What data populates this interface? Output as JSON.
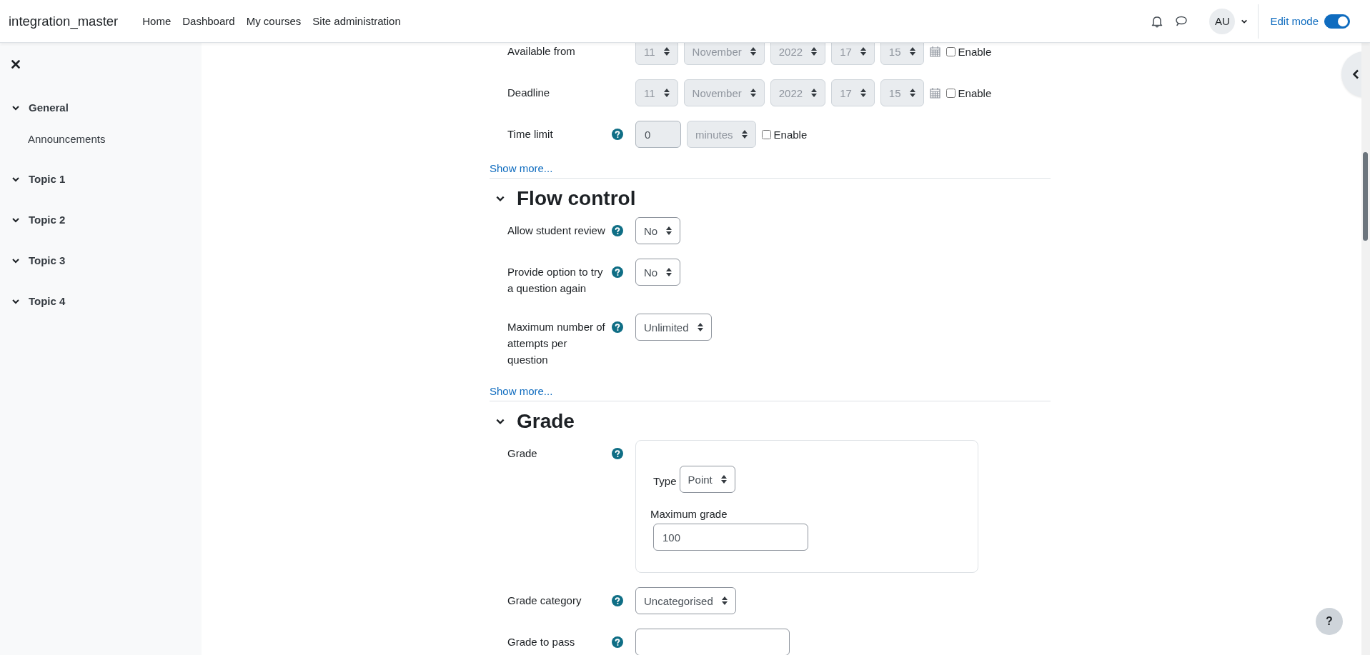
{
  "navbar": {
    "site_name": "integration_master",
    "links": [
      {
        "label": "Home"
      },
      {
        "label": "Dashboard"
      },
      {
        "label": "My courses"
      },
      {
        "label": "Site administration"
      }
    ],
    "user_initials": "AU",
    "edit_mode": {
      "label": "Edit mode",
      "on": true
    }
  },
  "course_index": {
    "items": [
      {
        "label": "General",
        "expanded": true,
        "children": [
          {
            "label": "Announcements"
          }
        ]
      },
      {
        "label": "Topic 1",
        "expanded": true
      },
      {
        "label": "Topic 2",
        "expanded": true
      },
      {
        "label": "Topic 3",
        "expanded": true
      },
      {
        "label": "Topic 4",
        "expanded": true
      }
    ]
  },
  "form": {
    "sections": [
      {
        "rows": [
          {
            "kind": "date_time",
            "label": "Available from",
            "help": false,
            "disabled": true,
            "fields": [
              "11",
              "November",
              "2022",
              "17",
              "15"
            ],
            "enable": {
              "label": "Enable",
              "checked": false
            }
          },
          {
            "kind": "date_time",
            "label": "Deadline",
            "help": false,
            "disabled": true,
            "fields": [
              "11",
              "November",
              "2022",
              "17",
              "15"
            ],
            "enable": {
              "label": "Enable",
              "checked": false
            }
          },
          {
            "kind": "duration",
            "label": "Time limit",
            "help": true,
            "disabled": true,
            "value": "0",
            "unit": "minutes",
            "enable": {
              "label": "Enable",
              "checked": false
            }
          }
        ],
        "show_more": "Show more..."
      },
      {
        "heading": "Flow control",
        "expanded": true,
        "rows": [
          {
            "kind": "select",
            "label": "Allow student review",
            "help": true,
            "value": "No"
          },
          {
            "kind": "select",
            "label": "Provide option to try a question again",
            "help": true,
            "value": "No"
          },
          {
            "kind": "select",
            "label": "Maximum number of attempts per question",
            "help": true,
            "value": "Unlimited"
          }
        ],
        "show_more": "Show more..."
      },
      {
        "heading": "Grade",
        "expanded": true,
        "rows": [
          {
            "kind": "grade_group",
            "label": "Grade",
            "help": true,
            "type_label": "Type",
            "type_value": "Point",
            "max_label": "Maximum grade",
            "max_value": "100"
          },
          {
            "kind": "select",
            "label": "Grade category",
            "help": true,
            "value": "Uncategorised"
          },
          {
            "kind": "text",
            "label": "Grade to pass",
            "help": true
          }
        ]
      }
    ]
  },
  "help_button": {
    "label": "?"
  }
}
